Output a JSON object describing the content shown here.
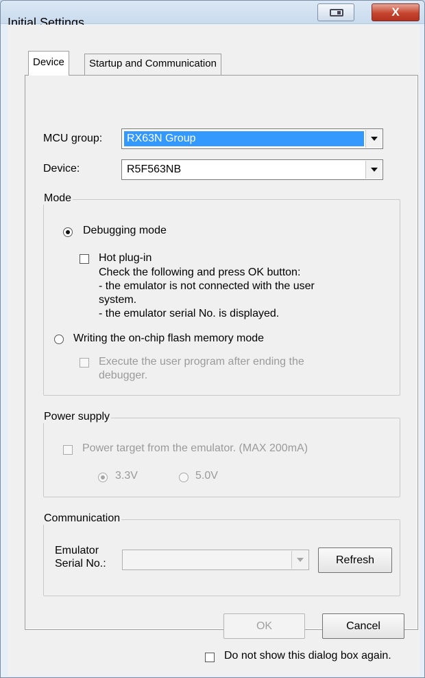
{
  "window": {
    "title": "Initial Settings",
    "close_glyph": "X",
    "restore_icon": "restore-icon"
  },
  "tabs": [
    {
      "label": "Device",
      "active": true
    },
    {
      "label": "Startup and Communication",
      "active": false
    }
  ],
  "device_tab": {
    "mcu_group_label": "MCU group:",
    "mcu_group_value": "RX63N Group",
    "device_label": "Device:",
    "device_value": "R5F563NB",
    "mode": {
      "legend": "Mode",
      "debugging_mode": "Debugging mode",
      "hot_plugin": "Hot plug-in",
      "hot_plugin_help": [
        "Check the following and press OK button:",
        "- the emulator is not connected with the user",
        "system.",
        "- the emulator serial No. is displayed."
      ],
      "writing_mode": "Writing the on-chip flash memory mode",
      "execute_after": [
        "Execute the user program after ending the",
        "debugger."
      ]
    },
    "power": {
      "legend": "Power supply",
      "power_target": "Power target from the emulator. (MAX 200mA)",
      "v33": "3.3V",
      "v50": "5.0V"
    },
    "communication": {
      "legend": "Communication",
      "serial_label": [
        "Emulator",
        "Serial No.:"
      ],
      "serial_value": "",
      "refresh": "Refresh"
    }
  },
  "footer": {
    "ok": "OK",
    "cancel": "Cancel",
    "dont_show": "Do not show this dialog box again."
  },
  "state": {
    "debugging_mode_selected": true,
    "writing_mode_selected": false,
    "hot_plugin_checked": false,
    "execute_after_checked": false,
    "power_target_checked": false,
    "v33_selected": true,
    "dont_show_checked": false
  }
}
